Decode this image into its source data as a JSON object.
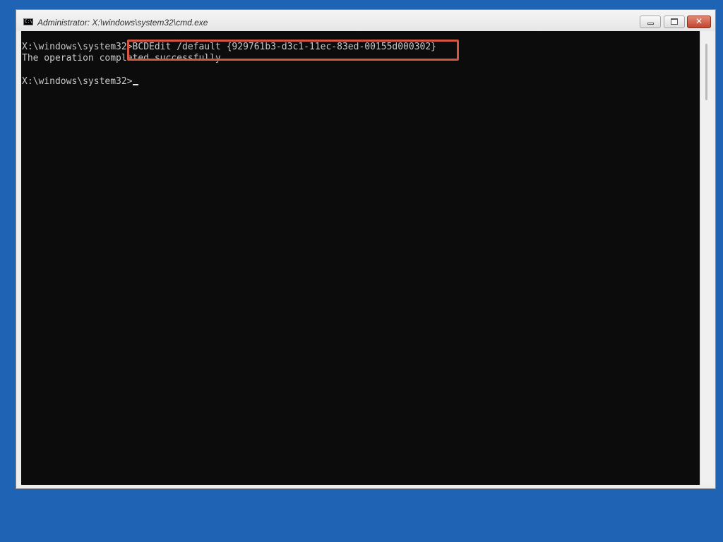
{
  "window": {
    "title": "Administrator: X:\\windows\\system32\\cmd.exe",
    "app_icon_text": "C:\\",
    "controls": {
      "minimize": "minimize",
      "maximize": "maximize",
      "close": "✕"
    }
  },
  "console": {
    "lines": [
      {
        "prompt": "X:\\windows\\system32>",
        "command": "BCDEdit /default {929761b3-d3c1-11ec-83ed-00155d000302}"
      },
      {
        "text": "The operation completed successfully."
      },
      {
        "prompt": "X:\\windows\\system32>",
        "command": ""
      }
    ],
    "highlight_color": "#d6573f",
    "text_color": "#c8c8c8",
    "background_color": "#0c0c0c"
  },
  "desktop": {
    "background_color": "#1e63b4"
  }
}
